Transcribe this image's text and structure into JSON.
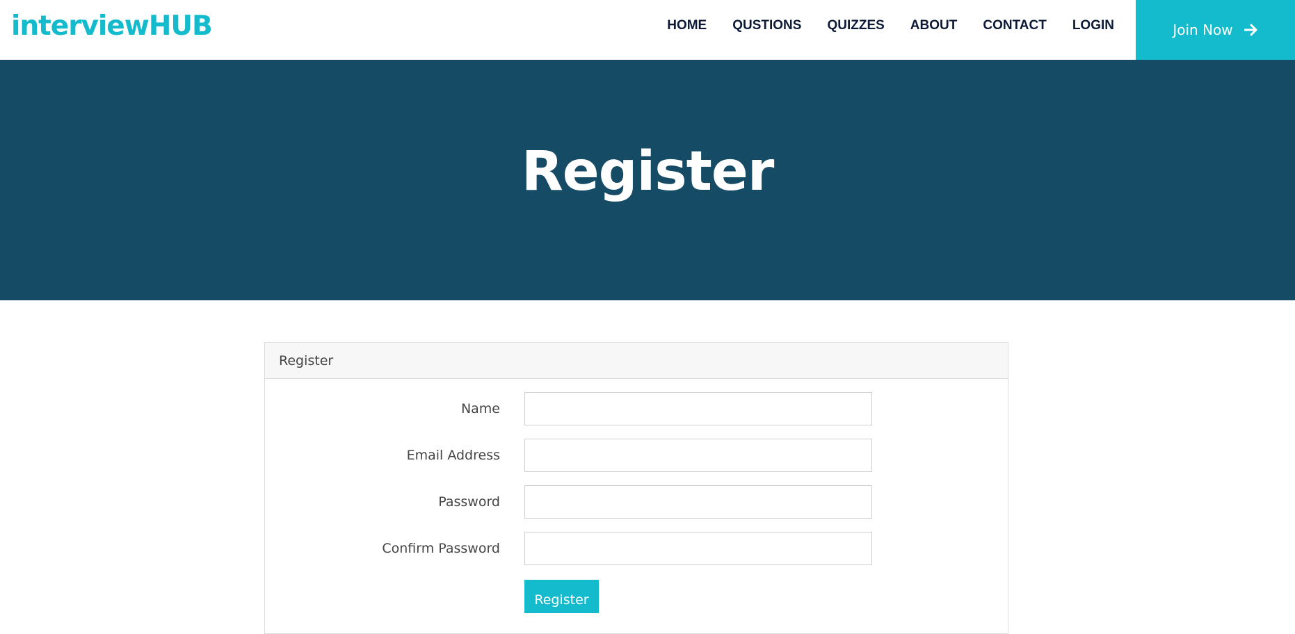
{
  "brand": {
    "logo_text": "interviewHUB",
    "accent_color": "#13bbcc",
    "hero_color": "#164b66"
  },
  "nav": {
    "items": [
      {
        "label": "HOME"
      },
      {
        "label": "QUSTIONS"
      },
      {
        "label": "QUIZZES"
      },
      {
        "label": "ABOUT"
      },
      {
        "label": "CONTACT"
      },
      {
        "label": "LOGIN"
      }
    ],
    "cta_label": "Join Now",
    "cta_icon": "arrow-right-icon"
  },
  "hero": {
    "title": "Register"
  },
  "form": {
    "header": "Register",
    "fields": [
      {
        "label": "Name",
        "value": ""
      },
      {
        "label": "Email Address",
        "value": ""
      },
      {
        "label": "Password",
        "value": ""
      },
      {
        "label": "Confirm Password",
        "value": ""
      }
    ],
    "submit_label": "Register"
  }
}
